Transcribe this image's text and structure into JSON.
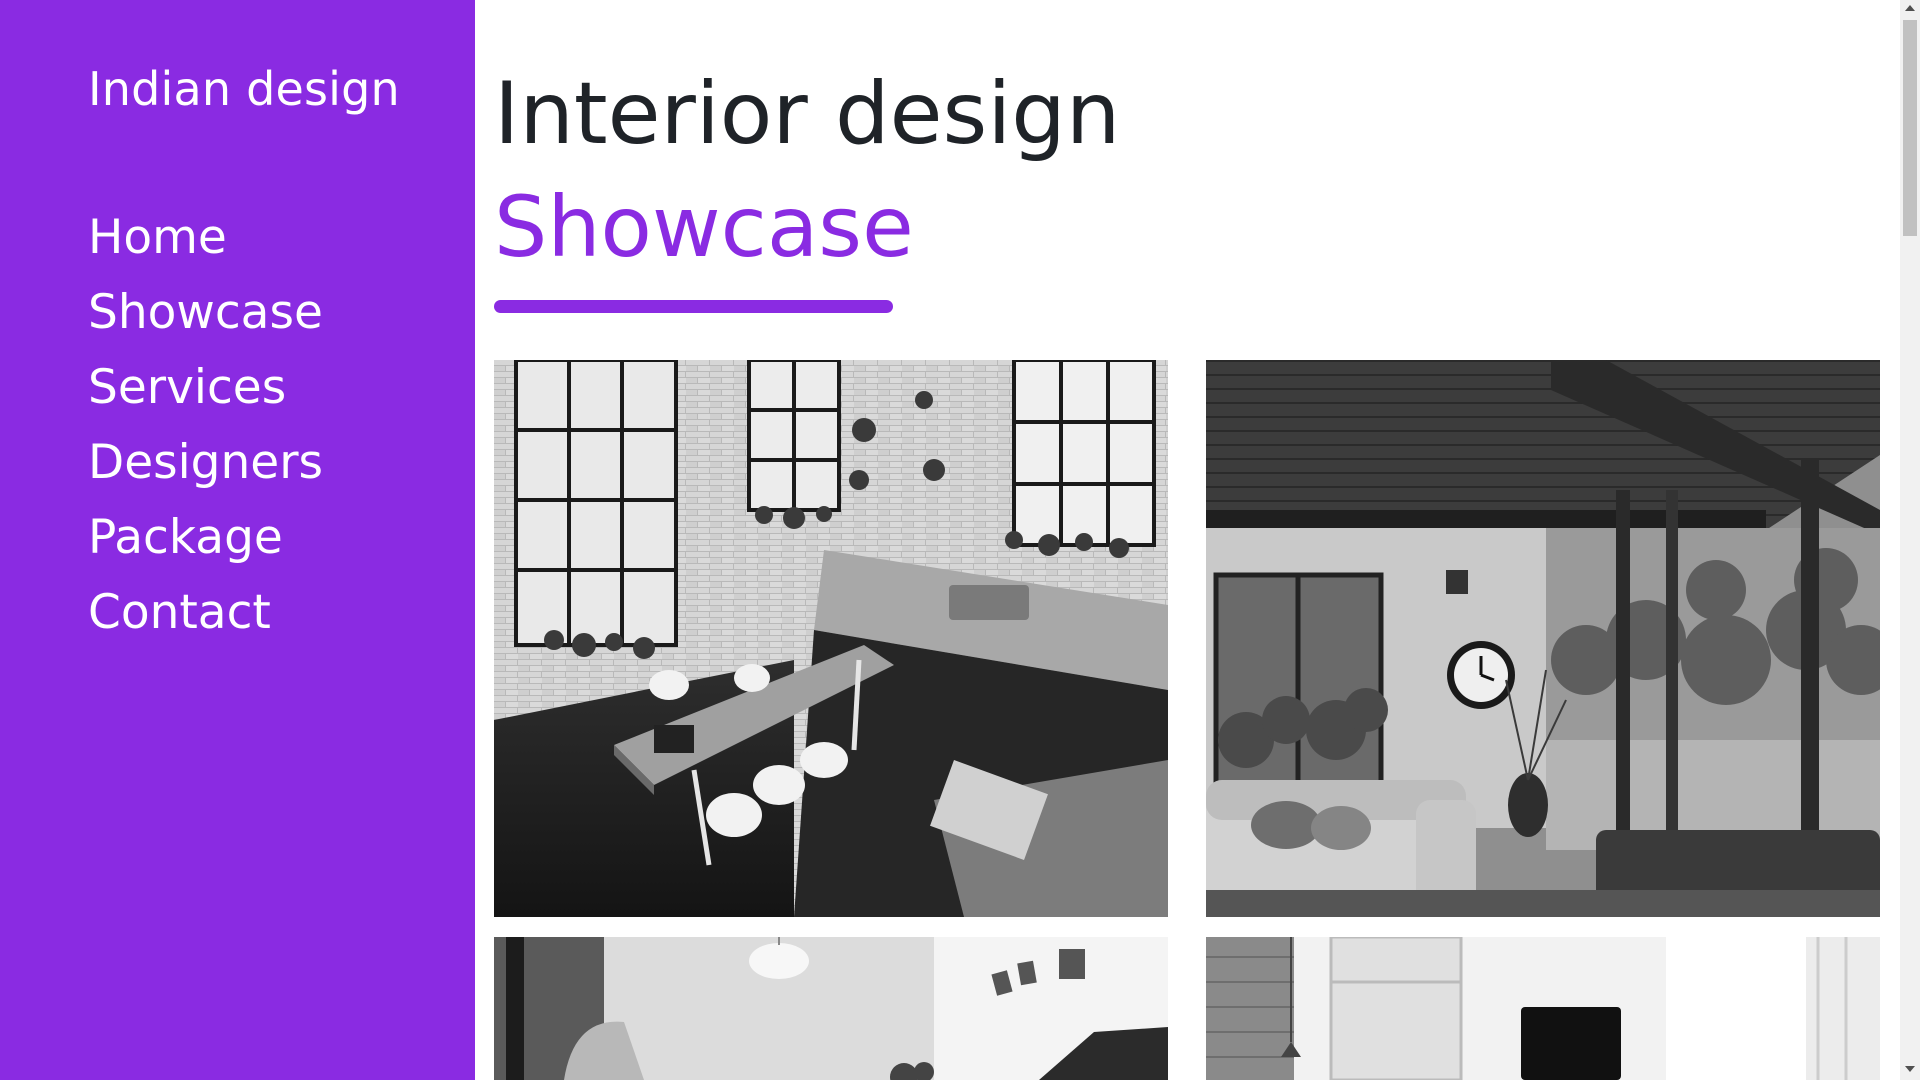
{
  "brand": "Indian design",
  "nav": [
    {
      "label": "Home"
    },
    {
      "label": "Showcase"
    },
    {
      "label": "Services"
    },
    {
      "label": "Designers"
    },
    {
      "label": "Package"
    },
    {
      "label": "Contact"
    }
  ],
  "heading": {
    "title": "Interior design",
    "subtitle": "Showcase"
  },
  "colors": {
    "accent": "#8a2be2",
    "text": "#1f2328",
    "background": "#ffffff"
  },
  "gallery": [
    {
      "icon": "kitchen-dining-photo"
    },
    {
      "icon": "living-room-photo"
    },
    {
      "icon": "bedroom-photo"
    },
    {
      "icon": "white-room-photo"
    }
  ]
}
